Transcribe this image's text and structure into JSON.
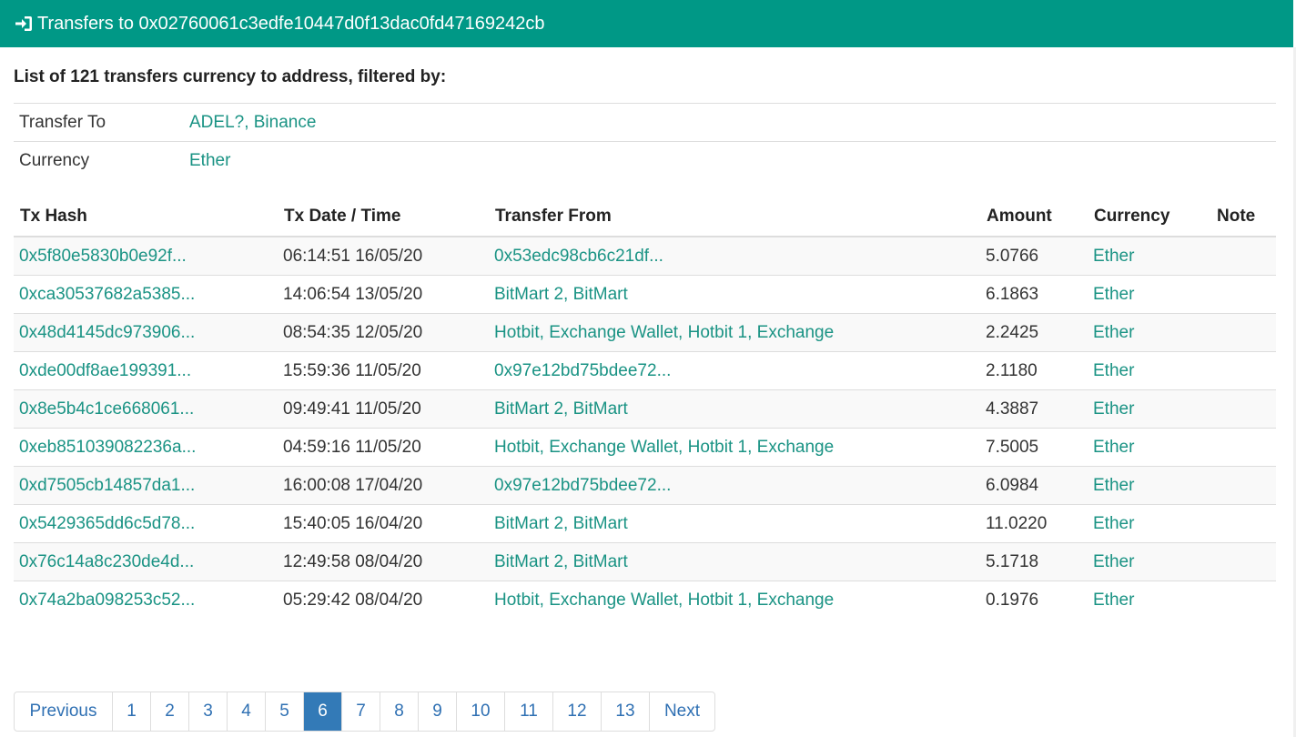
{
  "header": {
    "icon": "sign-in-icon",
    "title": "Transfers to 0x02760061c3edfe10447d0f13dac0fd47169242cb"
  },
  "summary": "List of 121 transfers currency to address, filtered by:",
  "filters": [
    {
      "label": "Transfer To",
      "value": "ADEL?, Binance"
    },
    {
      "label": "Currency",
      "value": "Ether"
    }
  ],
  "table": {
    "headers": [
      "Tx Hash",
      "Tx Date / Time",
      "Transfer From",
      "Amount",
      "Currency",
      "Note"
    ],
    "rows": [
      {
        "hash": "0x5f80e5830b0e92f...",
        "date": "06:14:51 16/05/20",
        "from": "0x53edc98cb6c21df...",
        "amount": "5.0766",
        "currency": "Ether",
        "note": ""
      },
      {
        "hash": "0xca30537682a5385...",
        "date": "14:06:54 13/05/20",
        "from": "BitMart 2, BitMart",
        "amount": "6.1863",
        "currency": "Ether",
        "note": ""
      },
      {
        "hash": "0x48d4145dc973906...",
        "date": "08:54:35 12/05/20",
        "from": "Hotbit, Exchange Wallet, Hotbit 1, Exchange",
        "amount": "2.2425",
        "currency": "Ether",
        "note": ""
      },
      {
        "hash": "0xde00df8ae199391...",
        "date": "15:59:36 11/05/20",
        "from": "0x97e12bd75bdee72...",
        "amount": "2.1180",
        "currency": "Ether",
        "note": ""
      },
      {
        "hash": "0x8e5b4c1ce668061...",
        "date": "09:49:41 11/05/20",
        "from": "BitMart 2, BitMart",
        "amount": "4.3887",
        "currency": "Ether",
        "note": ""
      },
      {
        "hash": "0xeb851039082236a...",
        "date": "04:59:16 11/05/20",
        "from": "Hotbit, Exchange Wallet, Hotbit 1, Exchange",
        "amount": "7.5005",
        "currency": "Ether",
        "note": ""
      },
      {
        "hash": "0xd7505cb14857da1...",
        "date": "16:00:08 17/04/20",
        "from": "0x97e12bd75bdee72...",
        "amount": "6.0984",
        "currency": "Ether",
        "note": ""
      },
      {
        "hash": "0x5429365dd6c5d78...",
        "date": "15:40:05 16/04/20",
        "from": "BitMart 2, BitMart",
        "amount": "11.0220",
        "currency": "Ether",
        "note": ""
      },
      {
        "hash": "0x76c14a8c230de4d...",
        "date": "12:49:58 08/04/20",
        "from": "BitMart 2, BitMart",
        "amount": "5.1718",
        "currency": "Ether",
        "note": ""
      },
      {
        "hash": "0x74a2ba098253c52...",
        "date": "05:29:42 08/04/20",
        "from": "Hotbit, Exchange Wallet, Hotbit 1, Exchange",
        "amount": "0.1976",
        "currency": "Ether",
        "note": ""
      }
    ]
  },
  "pagination": {
    "previous": "Previous",
    "pages": [
      "1",
      "2",
      "3",
      "4",
      "5",
      "6",
      "7",
      "8",
      "9",
      "10",
      "11",
      "12",
      "13"
    ],
    "active": "6",
    "next": "Next"
  },
  "colors": {
    "header_bg": "#009886",
    "link": "#1a9384",
    "pager_active": "#337ab7"
  }
}
